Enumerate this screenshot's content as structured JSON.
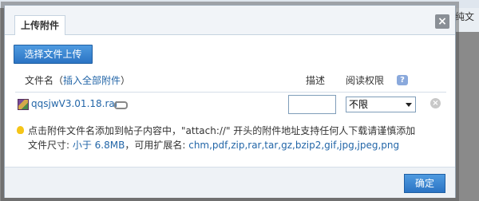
{
  "background": {
    "right_text": "纯文"
  },
  "dialog": {
    "tab_label": "上传附件",
    "close_label": "×",
    "choose_button": "选择文件上传",
    "columns": {
      "filename": "文件名",
      "filename_open": "（",
      "insert_all": "插入全部附件",
      "filename_close": "）",
      "description": "描述",
      "permission": "阅读权限",
      "help": "?"
    },
    "file": {
      "name": "qqsjwV3.01.18.rar",
      "description_value": "",
      "permission_value": "不限",
      "delete_label": "×"
    },
    "tips": {
      "line1": "点击附件文件名添加到帖子内容中，\"attach://\" 开头的附件地址支持任何人下载请谨慎添加",
      "line2_prefix": "文件尺寸: ",
      "size_limit": "小于 6.8MB",
      "line2_mid": "，可用扩展名: ",
      "extensions": "chm,pdf,zip,rar,tar,gz,bzip2,gif,jpg,jpeg,png"
    },
    "confirm_button": "确定"
  },
  "colors": {
    "link_blue": "#2366a8",
    "button_blue": "#2b74c4"
  }
}
